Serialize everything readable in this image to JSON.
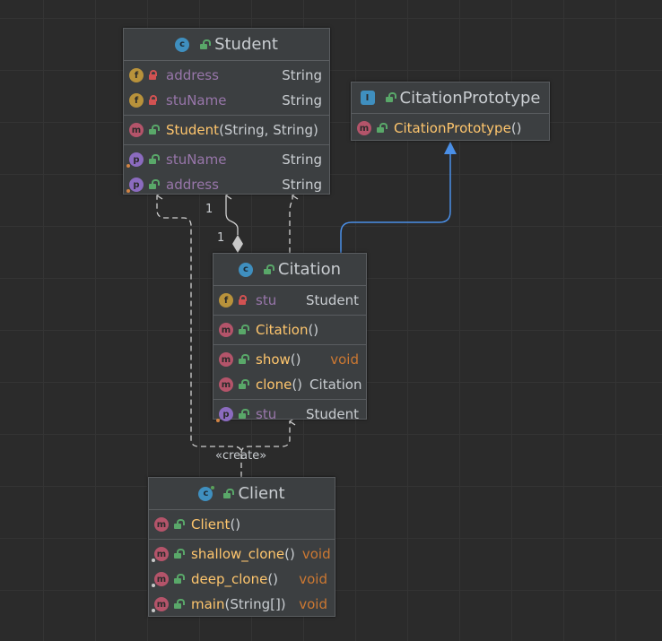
{
  "colors": {
    "background": "#2b2b2b",
    "node_bg": "#3c3f41",
    "field_name": "#9876aa",
    "method_name": "#ffc66d",
    "type_text": "#c9cdd1",
    "void_keyword": "#cc7832",
    "inheritance_edge": "#4a8fe7",
    "dependency_edge": "#d0d0d0"
  },
  "student": {
    "title": "Student",
    "fields": [
      {
        "name": "address",
        "type": "String"
      },
      {
        "name": "stuName",
        "type": "String"
      }
    ],
    "constructor": {
      "name": "Student",
      "params": "(String, String)"
    },
    "properties": [
      {
        "name": "stuName",
        "type": "String"
      },
      {
        "name": "address",
        "type": "String"
      }
    ]
  },
  "prototype": {
    "title": "CitationPrototype",
    "constructor": {
      "name": "CitationPrototype",
      "params": "()"
    }
  },
  "citation": {
    "title": "Citation",
    "fields": [
      {
        "name": "stu",
        "type": "Student"
      }
    ],
    "constructor": {
      "name": "Citation",
      "params": "()"
    },
    "methods": [
      {
        "name": "show",
        "params": "()",
        "type": "void"
      },
      {
        "name": "clone",
        "params": "()",
        "type": "Citation"
      }
    ],
    "properties": [
      {
        "name": "stu",
        "type": "Student"
      }
    ]
  },
  "client": {
    "title": "Client",
    "constructor": {
      "name": "Client",
      "params": "()"
    },
    "methods": [
      {
        "name": "shallow_clone",
        "params": "()",
        "type": "void"
      },
      {
        "name": "deep_clone",
        "params": "()",
        "type": "void"
      },
      {
        "name": "main",
        "params": "(String[])",
        "type": "void"
      }
    ]
  },
  "labels": {
    "multiplicity_student_end": "1",
    "multiplicity_citation_end": "1",
    "create_stereotype": "«create»"
  }
}
